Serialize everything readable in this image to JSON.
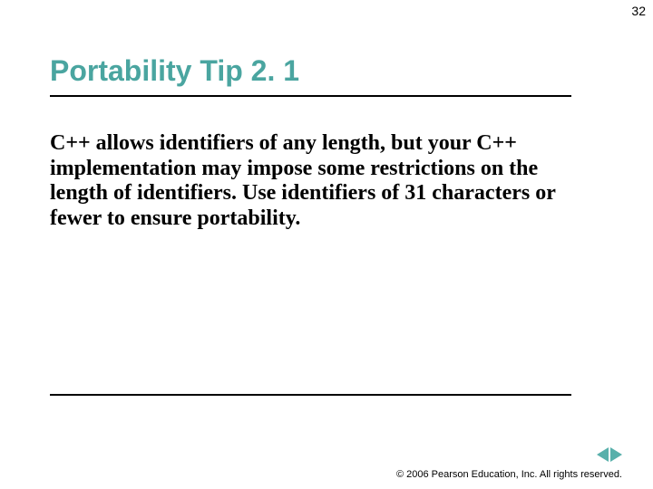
{
  "page_number": "32",
  "title": "Portability Tip 2. 1",
  "body": "C++ allows identifiers of any length, but your C++ implementation may impose some restrictions on the length of identifiers. Use identifiers of 31 characters or fewer to ensure portability.",
  "copyright": "© 2006 Pearson Education, Inc.  All rights reserved."
}
